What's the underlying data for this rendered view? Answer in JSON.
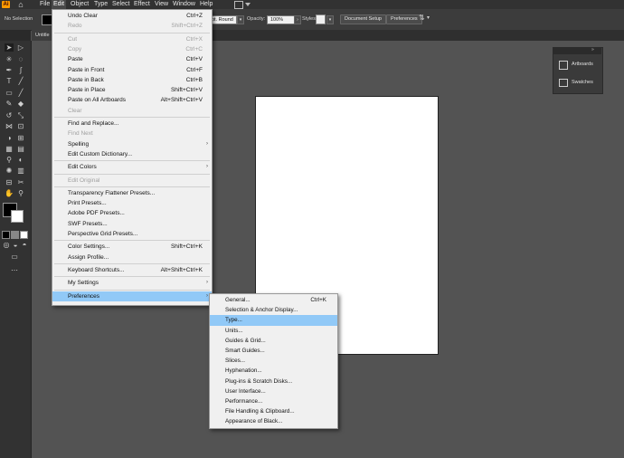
{
  "menubar": {
    "logo": "Ai",
    "items": [
      "File",
      "Edit",
      "Object",
      "Type",
      "Select",
      "Effect",
      "View",
      "Window",
      "Help"
    ]
  },
  "control": {
    "selection": "No Selection",
    "stroke_style": "pt. Round",
    "opacity_label": "Opacity:",
    "opacity_value": "100%",
    "styles_label": "Styles:",
    "document_setup": "Document Setup",
    "preferences": "Preferences"
  },
  "doc_tab": {
    "title": "Untitle"
  },
  "panels": {
    "artboards": "Artboards",
    "swatches": "Swatches"
  },
  "edit_menu": [
    {
      "label": "Undo Clear",
      "shortcut": "Ctrl+Z",
      "disabled": false
    },
    {
      "label": "Redo",
      "shortcut": "Shift+Ctrl+Z",
      "disabled": true
    },
    {
      "sep": true
    },
    {
      "label": "Cut",
      "shortcut": "Ctrl+X",
      "disabled": true
    },
    {
      "label": "Copy",
      "shortcut": "Ctrl+C",
      "disabled": true
    },
    {
      "label": "Paste",
      "shortcut": "Ctrl+V",
      "disabled": false
    },
    {
      "label": "Paste in Front",
      "shortcut": "Ctrl+F",
      "disabled": false
    },
    {
      "label": "Paste in Back",
      "shortcut": "Ctrl+B",
      "disabled": false
    },
    {
      "label": "Paste in Place",
      "shortcut": "Shift+Ctrl+V",
      "disabled": false
    },
    {
      "label": "Paste on All Artboards",
      "shortcut": "Alt+Shift+Ctrl+V",
      "disabled": false
    },
    {
      "label": "Clear",
      "shortcut": "",
      "disabled": true
    },
    {
      "sep": true
    },
    {
      "label": "Find and Replace...",
      "shortcut": "",
      "disabled": false
    },
    {
      "label": "Find Next",
      "shortcut": "",
      "disabled": true
    },
    {
      "label": "Spelling",
      "shortcut": "",
      "disabled": false,
      "submenu": true
    },
    {
      "label": "Edit Custom Dictionary...",
      "shortcut": "",
      "disabled": false
    },
    {
      "sep": true
    },
    {
      "label": "Edit Colors",
      "shortcut": "",
      "disabled": false,
      "submenu": true
    },
    {
      "sep": true
    },
    {
      "label": "Edit Original",
      "shortcut": "",
      "disabled": true
    },
    {
      "sep": true
    },
    {
      "label": "Transparency Flattener Presets...",
      "shortcut": "",
      "disabled": false
    },
    {
      "label": "Print Presets...",
      "shortcut": "",
      "disabled": false
    },
    {
      "label": "Adobe PDF Presets...",
      "shortcut": "",
      "disabled": false
    },
    {
      "label": "SWF Presets...",
      "shortcut": "",
      "disabled": false
    },
    {
      "label": "Perspective Grid Presets...",
      "shortcut": "",
      "disabled": false
    },
    {
      "sep": true
    },
    {
      "label": "Color Settings...",
      "shortcut": "Shift+Ctrl+K",
      "disabled": false
    },
    {
      "label": "Assign Profile...",
      "shortcut": "",
      "disabled": false
    },
    {
      "sep": true
    },
    {
      "label": "Keyboard Shortcuts...",
      "shortcut": "Alt+Shift+Ctrl+K",
      "disabled": false
    },
    {
      "sep": true
    },
    {
      "label": "My Settings",
      "shortcut": "",
      "disabled": false,
      "submenu": true
    },
    {
      "sep": true
    },
    {
      "label": "Preferences",
      "shortcut": "",
      "disabled": false,
      "submenu": true,
      "highlight": true
    }
  ],
  "preferences_menu": [
    {
      "label": "General...",
      "shortcut": "Ctrl+K"
    },
    {
      "label": "Selection & Anchor Display...",
      "shortcut": ""
    },
    {
      "label": "Type...",
      "shortcut": "",
      "highlight": true
    },
    {
      "label": "Units...",
      "shortcut": ""
    },
    {
      "label": "Guides & Grid...",
      "shortcut": ""
    },
    {
      "label": "Smart Guides...",
      "shortcut": ""
    },
    {
      "label": "Slices...",
      "shortcut": ""
    },
    {
      "label": "Hyphenation...",
      "shortcut": ""
    },
    {
      "label": "Plug-ins & Scratch Disks...",
      "shortcut": ""
    },
    {
      "label": "User Interface...",
      "shortcut": ""
    },
    {
      "label": "Performance...",
      "shortcut": ""
    },
    {
      "label": "File Handling & Clipboard...",
      "shortcut": ""
    },
    {
      "label": "Appearance of Black...",
      "shortcut": ""
    }
  ]
}
